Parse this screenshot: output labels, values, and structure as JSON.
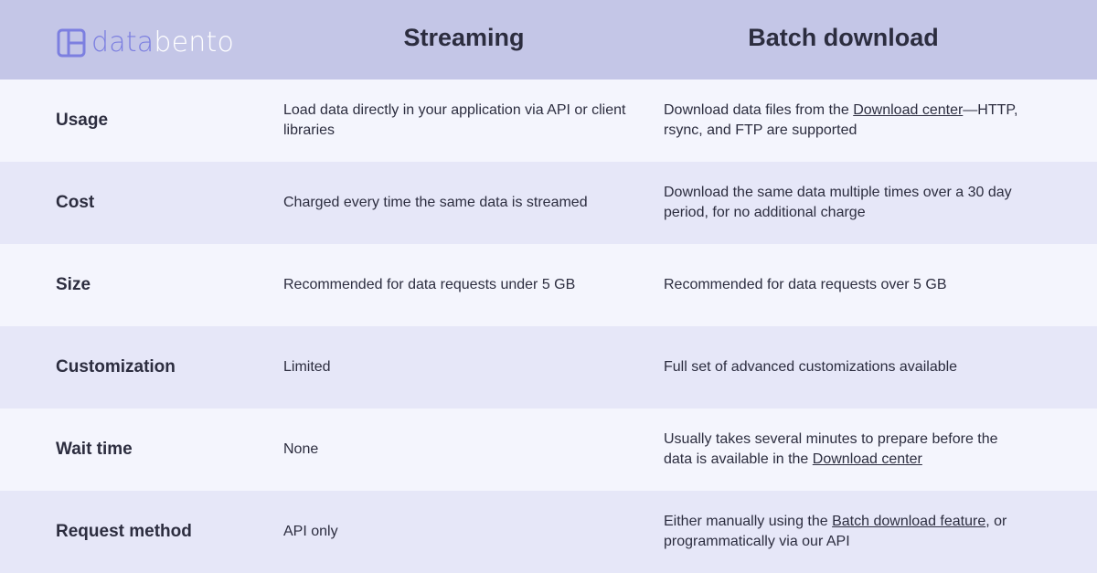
{
  "brand": {
    "part1": "data",
    "part2": "bento"
  },
  "columns": {
    "streaming": "Streaming",
    "batch": "Batch download"
  },
  "rows": [
    {
      "label": "Usage",
      "streaming": "Load data directly in your application via API or client libraries",
      "batch_before": "Download data files from the ",
      "batch_link": "Download center",
      "batch_after": "—HTTP, rsync, and FTP are supported"
    },
    {
      "label": "Cost",
      "streaming": "Charged every time the same data is streamed",
      "batch_before": "Download the same data multiple times over a 30 day period, for no additional charge",
      "batch_link": "",
      "batch_after": ""
    },
    {
      "label": "Size",
      "streaming": "Recommended for data requests under 5 GB",
      "batch_before": "Recommended for data requests over 5 GB",
      "batch_link": "",
      "batch_after": ""
    },
    {
      "label": "Customization",
      "streaming": "Limited",
      "batch_before": "Full set of advanced customizations available",
      "batch_link": "",
      "batch_after": ""
    },
    {
      "label": "Wait time",
      "streaming": "None",
      "batch_before": "Usually takes several minutes to prepare before the data is available in the ",
      "batch_link": "Download center",
      "batch_after": ""
    },
    {
      "label": "Request method",
      "streaming": "API only",
      "batch_before": "Either manually using the ",
      "batch_link": "Batch download feature",
      "batch_after": ", or programmatically via our API"
    }
  ],
  "colors": {
    "header_bg": "#c4c6e7",
    "row_light": "#f4f5fd",
    "row_dark": "#e6e7f8",
    "brand_accent": "#7c7fe0"
  }
}
